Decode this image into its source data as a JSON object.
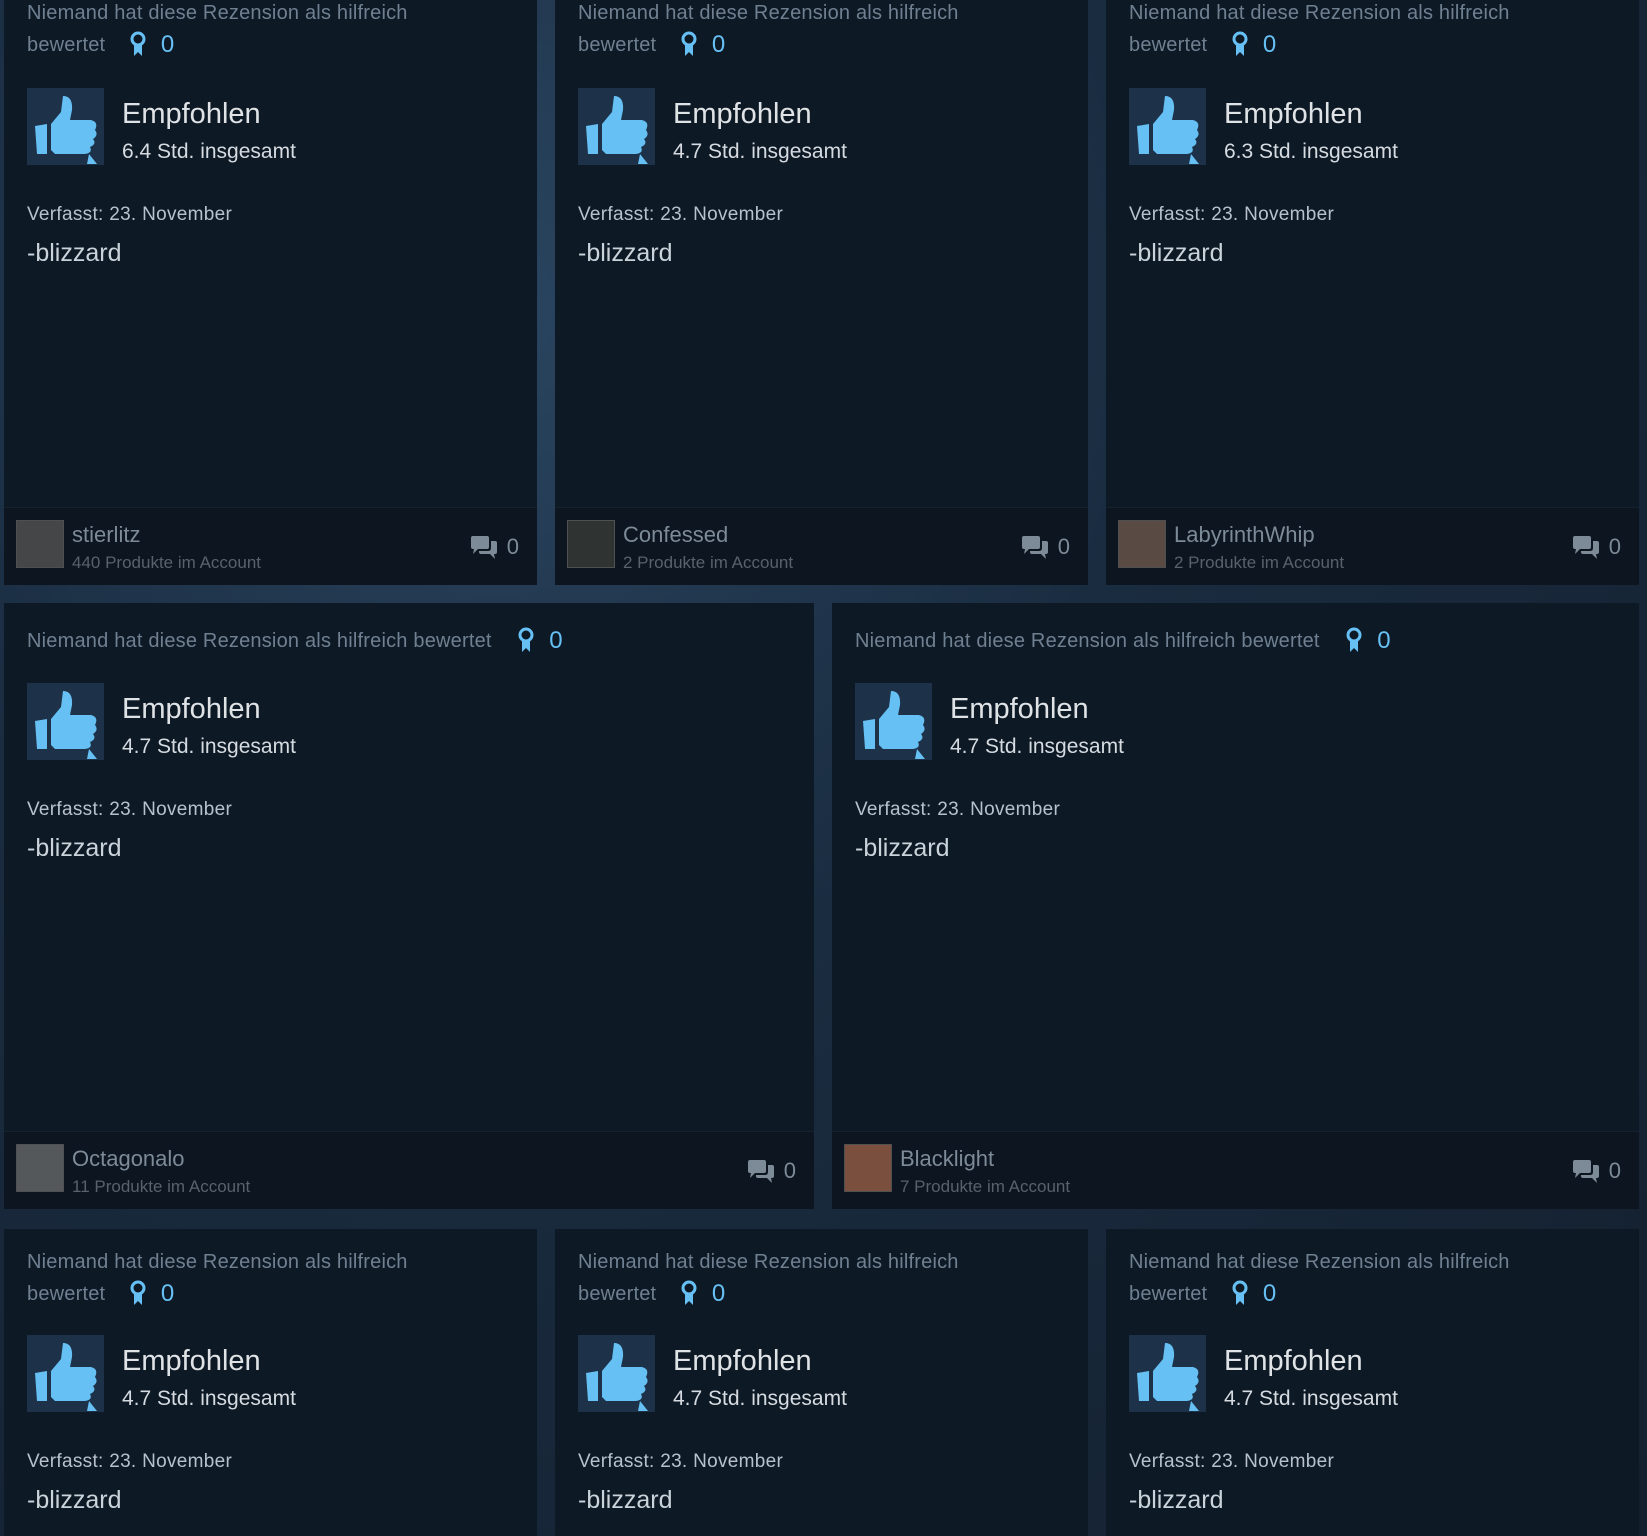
{
  "reviews": [
    {
      "helpful_line1": "Niemand hat diese Rezension als hilfreich",
      "helpful_line2": "bewertet",
      "helpful_count": "0",
      "title": "Empfohlen",
      "hours": "6.4 Std. insgesamt",
      "posted": "Verfasst: 23. November",
      "text": "-blizzard",
      "user": "stierlitz",
      "products": "440 Produkte im Account",
      "comments": "0"
    },
    {
      "helpful_line1": "Niemand hat diese Rezension als hilfreich",
      "helpful_line2": "bewertet",
      "helpful_count": "0",
      "title": "Empfohlen",
      "hours": "4.7 Std. insgesamt",
      "posted": "Verfasst: 23. November",
      "text": "-blizzard",
      "user": "Confessed",
      "products": "2 Produkte im Account",
      "comments": "0"
    },
    {
      "helpful_line1": "Niemand hat diese Rezension als hilfreich",
      "helpful_line2": "bewertet",
      "helpful_count": "0",
      "title": "Empfohlen",
      "hours": "6.3 Std. insgesamt",
      "posted": "Verfasst: 23. November",
      "text": "-blizzard",
      "user": "LabyrinthWhip",
      "products": "2 Produkte im Account",
      "comments": "0"
    },
    {
      "helpful_line1": "Niemand hat diese Rezension als hilfreich bewertet",
      "helpful_count": "0",
      "title": "Empfohlen",
      "hours": "4.7 Std. insgesamt",
      "posted": "Verfasst: 23. November",
      "text": "-blizzard",
      "user": "Octagonalo",
      "products": "11 Produkte im Account",
      "comments": "0"
    },
    {
      "helpful_line1": "Niemand hat diese Rezension als hilfreich bewertet",
      "helpful_count": "0",
      "title": "Empfohlen",
      "hours": "4.7 Std. insgesamt",
      "posted": "Verfasst: 23. November",
      "text": "-blizzard",
      "user": "Blacklight",
      "products": "7 Produkte im Account",
      "comments": "0"
    },
    {
      "helpful_line1": "Niemand hat diese Rezension als hilfreich",
      "helpful_line2": "bewertet",
      "helpful_count": "0",
      "title": "Empfohlen",
      "hours": "4.7 Std. insgesamt",
      "posted": "Verfasst: 23. November",
      "text": "-blizzard"
    },
    {
      "helpful_line1": "Niemand hat diese Rezension als hilfreich",
      "helpful_line2": "bewertet",
      "helpful_count": "0",
      "title": "Empfohlen",
      "hours": "4.7 Std. insgesamt",
      "posted": "Verfasst: 23. November",
      "text": "-blizzard"
    },
    {
      "helpful_line1": "Niemand hat diese Rezension als hilfreich",
      "helpful_line2": "bewertet",
      "helpful_count": "0",
      "title": "Empfohlen",
      "hours": "4.7 Std. insgesamt",
      "posted": "Verfasst: 23. November",
      "text": "-blizzard"
    }
  ],
  "icons": {
    "recommend": "thumbs-up-icon",
    "award": "award-icon",
    "comment": "comment-icon"
  },
  "colors": {
    "accent": "#66c0f4",
    "card_bg": "#0e1926",
    "thumb_bg": "#1d3249"
  }
}
